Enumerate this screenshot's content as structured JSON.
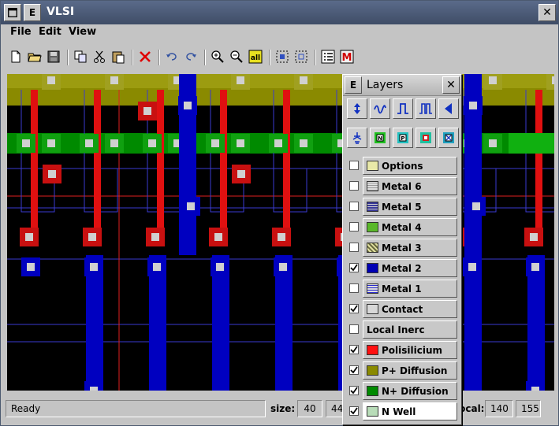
{
  "window": {
    "title": "VLSI",
    "menu_icon": "window-menu-icon",
    "e_button": "E",
    "close_button": "✕"
  },
  "menubar": [
    {
      "label": "File"
    },
    {
      "label": "Edit"
    },
    {
      "label": "View"
    }
  ],
  "toolbar": [
    {
      "icon": "new-file-icon"
    },
    {
      "icon": "open-folder-icon"
    },
    {
      "icon": "save-icon"
    },
    {
      "icon": "copy-icon"
    },
    {
      "icon": "cut-icon"
    },
    {
      "icon": "paste-icon"
    },
    {
      "icon": "delete-icon"
    },
    {
      "icon": "undo-icon"
    },
    {
      "icon": "redo-icon"
    },
    {
      "icon": "zoom-in-icon"
    },
    {
      "icon": "zoom-out-icon"
    },
    {
      "icon": "zoom-all-icon",
      "label": "all"
    },
    {
      "icon": "select-icon"
    },
    {
      "icon": "deselect-icon"
    },
    {
      "icon": "list-icon"
    },
    {
      "icon": "macro-icon",
      "label": "M"
    }
  ],
  "status": {
    "message": "Ready",
    "size_label": "size:",
    "size_w": "40",
    "size_h": "44",
    "local_label": "local:",
    "local_x": "140",
    "local_y": "155"
  },
  "layers_panel": {
    "e_button": "E",
    "title": "Layers",
    "close": "✕",
    "tool_row_1": [
      "up-down-arrow-icon",
      "wave-icon",
      "pulse-icon",
      "double-pulse-icon",
      "left-triangle-icon"
    ],
    "tool_row_2": [
      "transistor-icon",
      "n-well-icon",
      "p-well-icon",
      "contact-icon",
      "cross-contact-icon"
    ],
    "tool_row_2_labels": [
      "",
      "N",
      "P",
      "",
      ""
    ],
    "layers": [
      {
        "name": "Options",
        "checked": false,
        "color": "#e8e8a8",
        "pattern": "solid"
      },
      {
        "name": "Metal 6",
        "checked": false,
        "color": "#9a9a9a",
        "pattern": "grid"
      },
      {
        "name": "Metal 5",
        "checked": false,
        "color": "#3a3a9a",
        "pattern": "hlines"
      },
      {
        "name": "Metal 4",
        "checked": false,
        "color": "#5ab82a",
        "pattern": "solid"
      },
      {
        "name": "Metal 3",
        "checked": false,
        "color": "#6a6a40",
        "pattern": "diag"
      },
      {
        "name": "Metal 2",
        "checked": true,
        "color": "#0000b4",
        "pattern": "solid"
      },
      {
        "name": "Metal 1",
        "checked": false,
        "color": "#2a2ad0",
        "pattern": "grid"
      },
      {
        "name": "Contact",
        "checked": true,
        "color": "#d8d8d8",
        "pattern": "solid"
      },
      {
        "name": "Local Inerc",
        "checked": false,
        "color": "",
        "pattern": "none"
      },
      {
        "name": "Polisilicium",
        "checked": true,
        "color": "#ff1010",
        "pattern": "solid"
      },
      {
        "name": "P+ Diffusion",
        "checked": true,
        "color": "#8a8a00",
        "pattern": "solid"
      },
      {
        "name": "N+ Diffusion",
        "checked": true,
        "color": "#008a00",
        "pattern": "solid"
      },
      {
        "name": "N Well",
        "checked": true,
        "color": "#b8dcb8",
        "pattern": "solid"
      }
    ]
  },
  "colors": {
    "canvas_bg": "#000000",
    "p_diffusion": "#8a8a00",
    "n_diffusion": "#008a00",
    "poly": "#e01010",
    "metal2": "#0000c0",
    "metal1_lines": "#3a3ad0",
    "contact": "#d0d0d0",
    "contact_poly_bg": "#c80000",
    "guide_line": "#e02020"
  }
}
